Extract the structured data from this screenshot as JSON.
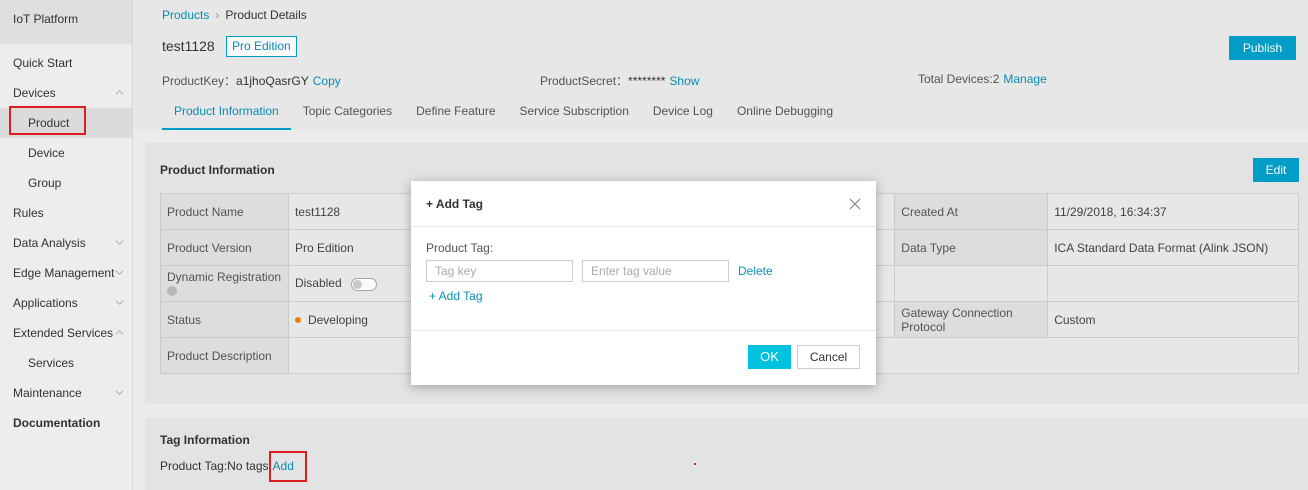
{
  "sidebar": {
    "brand": "IoT Platform",
    "items": [
      {
        "label": "Quick Start",
        "type": "top"
      },
      {
        "label": "Devices",
        "type": "top",
        "chevron": "up"
      },
      {
        "label": "Product",
        "type": "sub",
        "active": true
      },
      {
        "label": "Device",
        "type": "sub"
      },
      {
        "label": "Group",
        "type": "sub"
      },
      {
        "label": "Rules",
        "type": "top"
      },
      {
        "label": "Data Analysis",
        "type": "top",
        "chevron": "down"
      },
      {
        "label": "Edge Management",
        "type": "top",
        "chevron": "down"
      },
      {
        "label": "Applications",
        "type": "top",
        "chevron": "down"
      },
      {
        "label": "Extended Services",
        "type": "top",
        "chevron": "up"
      },
      {
        "label": "Services",
        "type": "sub"
      },
      {
        "label": "Maintenance",
        "type": "top",
        "chevron": "down"
      },
      {
        "label": "Documentation",
        "type": "top",
        "bold": true
      }
    ]
  },
  "breadcrumb": {
    "root": "Products",
    "separator": "›",
    "current": "Product Details"
  },
  "header": {
    "title": "test1128",
    "edition": "Pro Edition",
    "publish_label": "Publish",
    "product_key_label": "ProductKey：",
    "product_key_value": "a1jhoQasrGY",
    "copy_label": "Copy",
    "product_secret_label": "ProductSecret：",
    "product_secret_value": "********",
    "show_label": "Show",
    "total_devices_label": "Total Devices:",
    "total_devices_value": "2",
    "manage_label": "Manage"
  },
  "tabs": [
    {
      "label": "Product Information",
      "active": true
    },
    {
      "label": "Topic Categories"
    },
    {
      "label": "Define Feature"
    },
    {
      "label": "Service Subscription"
    },
    {
      "label": "Device Log"
    },
    {
      "label": "Online Debugging"
    }
  ],
  "product_info": {
    "title": "Product Information",
    "edit_label": "Edit",
    "product_name_label": "Product Name",
    "product_name": "test1128",
    "product_version_label": "Product Version",
    "product_version": "Pro Edition",
    "dynamic_registration_label": "Dynamic Registration",
    "dynamic_registration": "Disabled",
    "status_label": "Status",
    "status": "Developing",
    "product_description_label": "Product Description",
    "created_at_label": "Created At",
    "created_at": "11/29/2018, 16:34:37",
    "data_type_label": "Data Type",
    "data_type": "ICA Standard Data Format (Alink JSON)",
    "gateway_protocol_label": "Gateway Connection Protocol",
    "gateway_protocol": "Custom"
  },
  "tag_info": {
    "title": "Tag Information",
    "line_label": "Product Tag:No tags",
    "add_label": "Add"
  },
  "modal": {
    "title": "+ Add Tag",
    "field_label": "Product Tag:",
    "key_placeholder": "Tag key",
    "value_placeholder": "Enter tag value",
    "delete_label": "Delete",
    "add_tag_label": "+ Add Tag",
    "ok_label": "OK",
    "cancel_label": "Cancel"
  },
  "colors": {
    "accent": "#00a2ca",
    "link": "#0a8fb8",
    "status_developing": "#e8850c",
    "highlight_box": "#e02020"
  }
}
